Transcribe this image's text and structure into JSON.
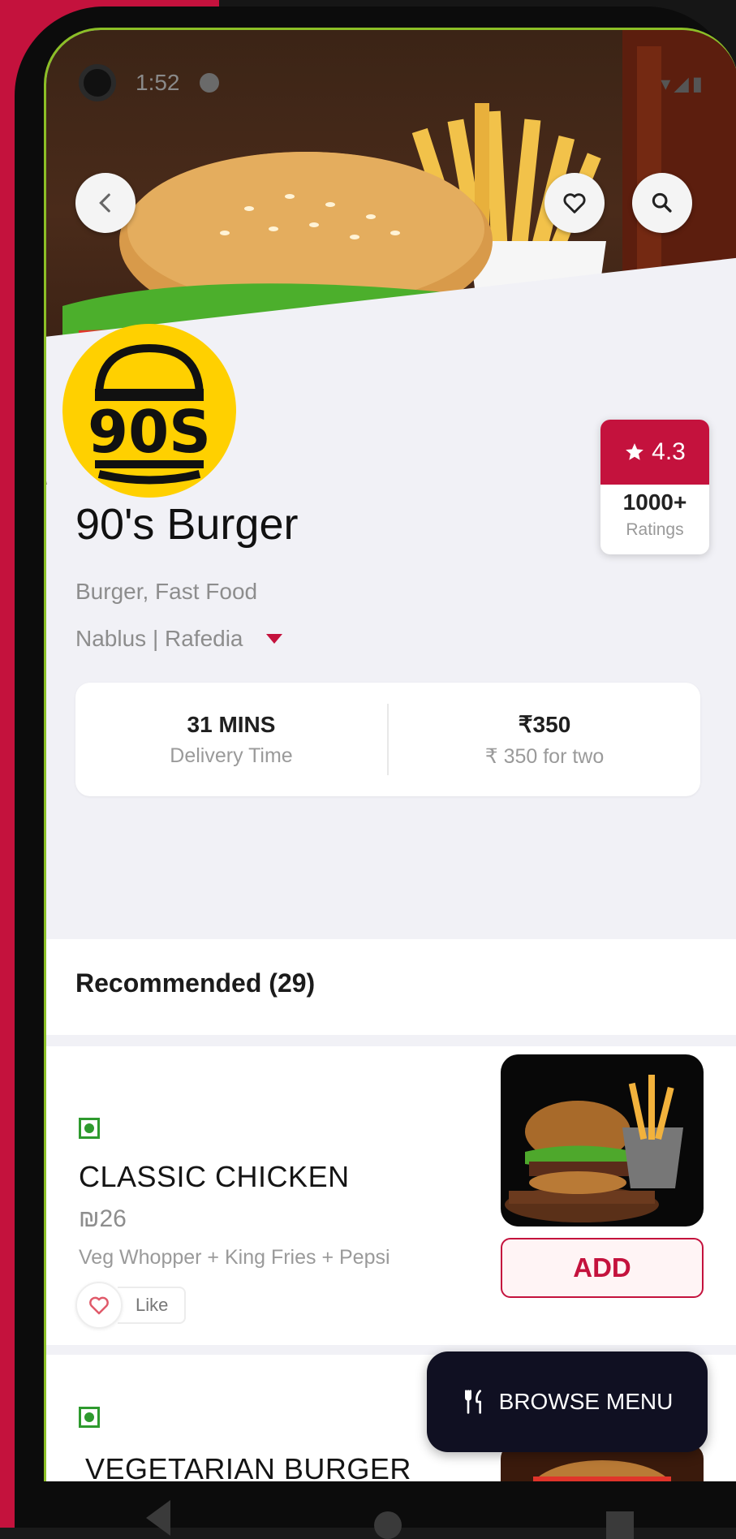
{
  "status_bar": {
    "time": "1:52",
    "right_icons": "▾◢▮"
  },
  "restaurant": {
    "logo_text": "90S",
    "name": "90's Burger",
    "cuisine": "Burger, Fast Food",
    "location": "Nablus | Rafedia"
  },
  "rating": {
    "value": "4.3",
    "count": "1000+",
    "label": "Ratings"
  },
  "info": {
    "time_value": "31 MINS",
    "time_label": "Delivery Time",
    "cost_value": "₹350",
    "cost_label": "₹ 350 for two"
  },
  "recommended": {
    "title": "Recommended (29)"
  },
  "items": [
    {
      "name": "CLASSIC CHICKEN",
      "price": "₪26",
      "description": "Veg Whopper + King Fries + Pepsi",
      "like_label": "Like",
      "add_label": "ADD"
    },
    {
      "name": "VEGETARIAN BURGER"
    }
  ],
  "browse_menu_label": "BROWSE MENU",
  "colors": {
    "accent": "#c4123d",
    "veg_green": "#2e9a2e",
    "dark_button": "#101022",
    "logo_yellow": "#ffd000"
  },
  "icons": [
    "back-chevron-icon",
    "favorite-heart-icon",
    "search-icon",
    "star-icon",
    "like-heart-icon",
    "cutlery-icon"
  ]
}
